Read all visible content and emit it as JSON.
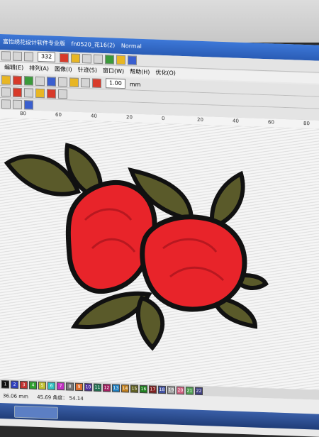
{
  "window": {
    "title": "富怡绣花设计软件专业版",
    "file": "fn0520_花16(2)",
    "mode": "Normal"
  },
  "toolbar": {
    "zoom": "332",
    "stitch_value": "1.00",
    "unit": "mm"
  },
  "menu": [
    "编辑(E)",
    "排列(A)",
    "图像(I)",
    "针迹(S)",
    "窗口(W)",
    "帮助(H)",
    "优化(O)"
  ],
  "ruler": [
    "80",
    "60",
    "40",
    "20",
    "0",
    "20",
    "40",
    "60",
    "80"
  ],
  "palette": [
    "1",
    "2",
    "3",
    "4",
    "5",
    "6",
    "7",
    "8",
    "9",
    "10",
    "11",
    "12",
    "13",
    "14",
    "15",
    "16",
    "17",
    "18",
    "19",
    "20",
    "21",
    "22"
  ],
  "status": {
    "left": "36.06 mm",
    "mid": "45.69 角度： 54.14"
  },
  "colors": {
    "rose": "#e8242a",
    "leaf": "#5a5a2a",
    "outline": "#111111"
  }
}
